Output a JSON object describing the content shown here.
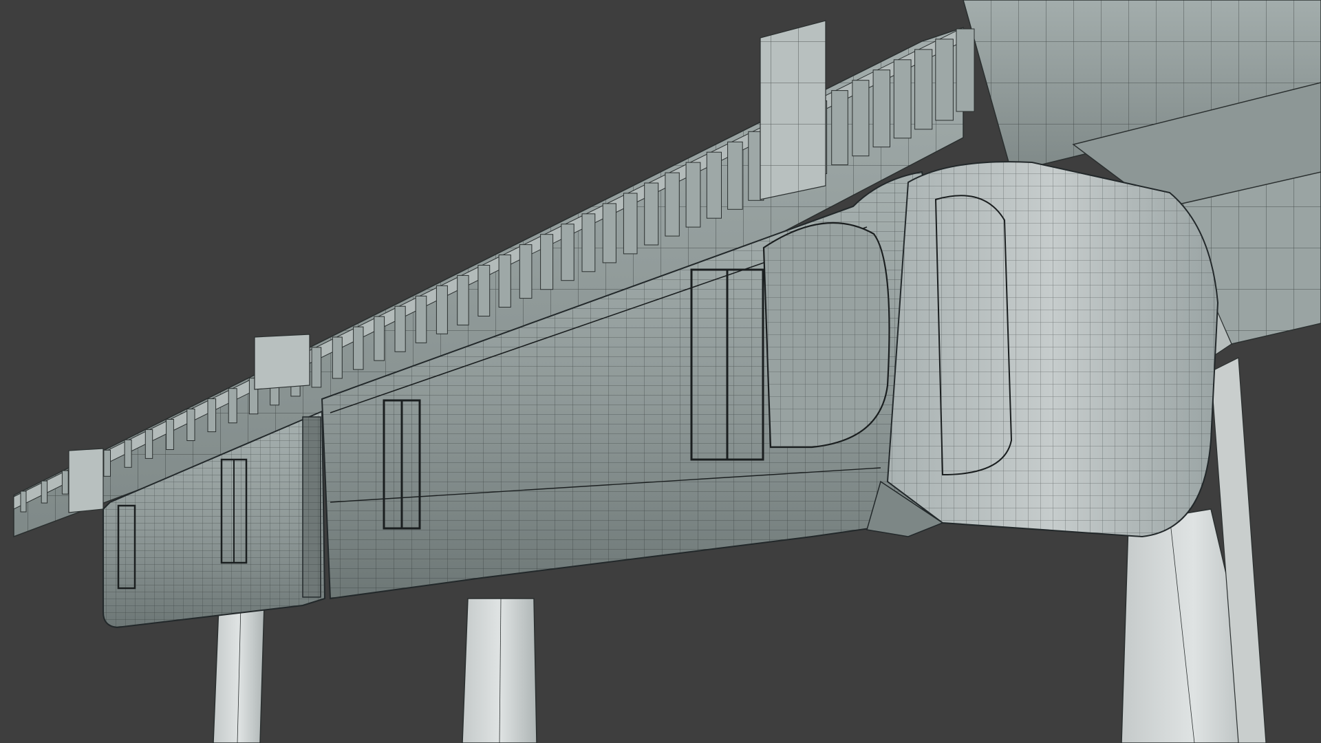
{
  "viewport": {
    "background_color": "#3e3e3e",
    "shading_mode": "wireframe-over-solid",
    "model_fill_color": "#8f9b9a",
    "model_highlight_color": "#c9cfcf",
    "model_shadow_color": "#5e6868",
    "wire_color": "#2a2f2f"
  },
  "scene": {
    "objects": [
      {
        "name": "guideway-beam",
        "icon": "beam-mesh"
      },
      {
        "name": "monorail-car-rear",
        "icon": "vehicle-mesh"
      },
      {
        "name": "monorail-car-front",
        "icon": "vehicle-mesh"
      },
      {
        "name": "support-pillars",
        "icon": "column-mesh"
      },
      {
        "name": "support-frame",
        "icon": "frame-mesh"
      }
    ]
  }
}
